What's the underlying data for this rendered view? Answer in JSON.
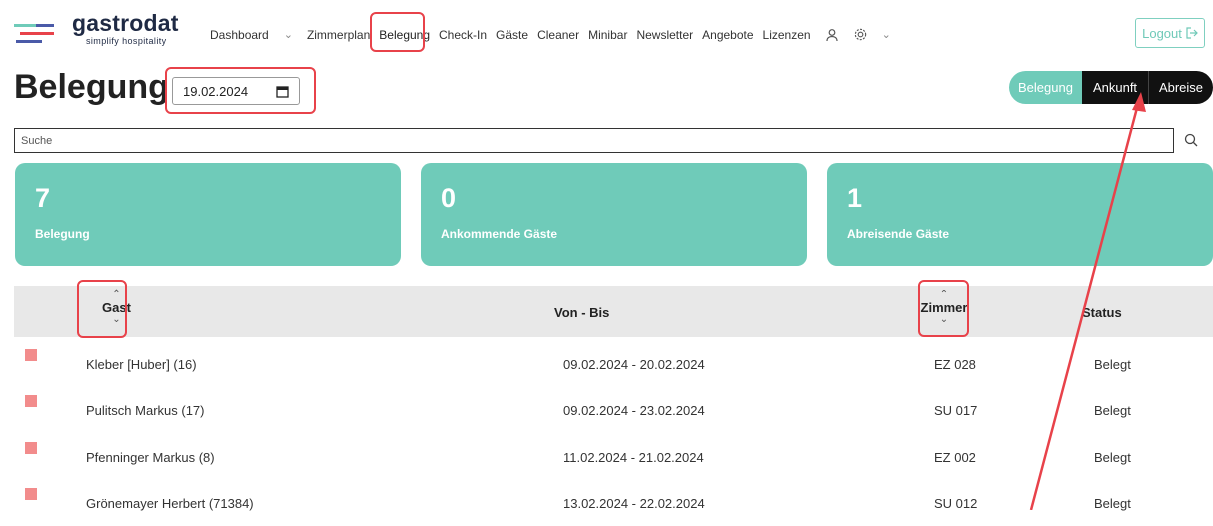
{
  "app": {
    "name": "gastrodat",
    "tagline": "simplify hospitality"
  },
  "nav": {
    "items": [
      "Dashboard",
      "Zimmerplan",
      "Belegung",
      "Check-In",
      "Gäste",
      "Cleaner",
      "Minibar",
      "Newsletter",
      "Angebote",
      "Lizenzen"
    ],
    "icons": [
      "user-icon",
      "gear-icon",
      "chevron-down-icon"
    ],
    "logout": "Logout"
  },
  "page": {
    "title": "Belegung",
    "date": "19.02.2024"
  },
  "view_toggle": [
    "Belegung",
    "Ankunft",
    "Abreise"
  ],
  "search": {
    "placeholder": "Suche"
  },
  "cards": [
    {
      "value": "7",
      "label": "Belegung"
    },
    {
      "value": "0",
      "label": "Ankommende Gäste"
    },
    {
      "value": "1",
      "label": "Abreisende Gäste"
    }
  ],
  "table": {
    "headers": {
      "guest": "Gast",
      "period": "Von - Bis",
      "room": "Zimmer",
      "status": "Status"
    },
    "rows": [
      {
        "guest": "Kleber [Huber] (16)",
        "period": "09.02.2024 - 20.02.2024",
        "room": "EZ 028",
        "status": "Belegt"
      },
      {
        "guest": "Pulitsch Markus (17)",
        "period": "09.02.2024 - 23.02.2024",
        "room": "SU 017",
        "status": "Belegt"
      },
      {
        "guest": "Pfenninger Markus (8)",
        "period": "11.02.2024 - 21.02.2024",
        "room": "EZ 002",
        "status": "Belegt"
      },
      {
        "guest": "Grönemayer Herbert (71384)",
        "period": "13.02.2024 - 22.02.2024",
        "room": "SU 012",
        "status": "Belegt"
      }
    ]
  },
  "colors": {
    "accent": "#6fcbb9",
    "status_marker": "#f28c8c",
    "annotation": "#e8424a"
  }
}
